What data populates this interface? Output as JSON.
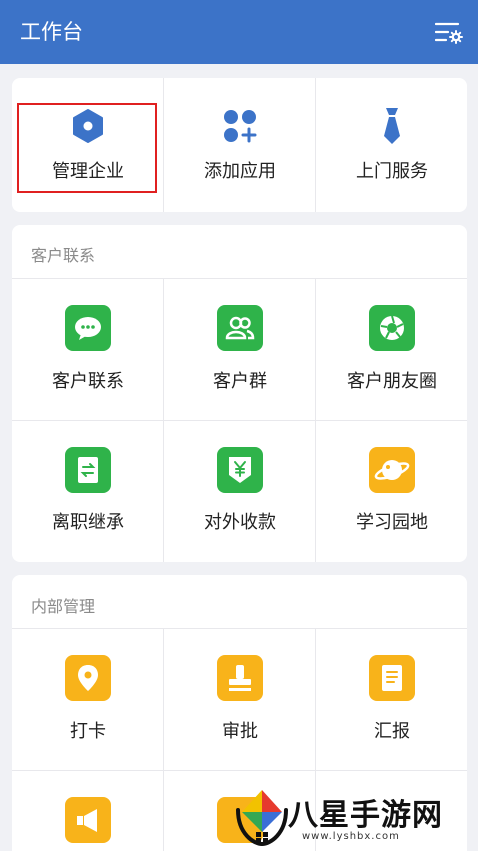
{
  "header": {
    "title": "工作台",
    "settings_icon": "settings-list-icon"
  },
  "top_actions": [
    {
      "label": "管理企业",
      "icon": "hexagon-icon",
      "color": "#3c73c8"
    },
    {
      "label": "添加应用",
      "icon": "apps-add-icon",
      "color": "#3c73c8"
    },
    {
      "label": "上门服务",
      "icon": "tie-icon",
      "color": "#3c73c8"
    }
  ],
  "customer_section": {
    "title": "客户联系",
    "items": [
      {
        "label": "客户联系",
        "icon": "chat-bubble-icon",
        "color": "#2fb34a"
      },
      {
        "label": "客户群",
        "icon": "group-icon",
        "color": "#2fb34a"
      },
      {
        "label": "客户朋友圈",
        "icon": "aperture-icon",
        "color": "#2fb34a"
      },
      {
        "label": "离职继承",
        "icon": "transfer-icon",
        "color": "#2fb34a"
      },
      {
        "label": "对外收款",
        "icon": "yuan-shield-icon",
        "color": "#2fb34a"
      },
      {
        "label": "学习园地",
        "icon": "planet-icon",
        "color": "#f8b31a"
      }
    ]
  },
  "internal_section": {
    "title": "内部管理",
    "items": [
      {
        "label": "打卡",
        "icon": "location-pin-icon",
        "color": "#f8b31a"
      },
      {
        "label": "审批",
        "icon": "stamp-icon",
        "color": "#f8b31a"
      },
      {
        "label": "汇报",
        "icon": "report-doc-icon",
        "color": "#f8b31a"
      },
      {
        "label": "",
        "icon": "megaphone-icon",
        "color": "#f8b31a"
      },
      {
        "label": "",
        "icon": "app-icon",
        "color": "#f8b31a"
      }
    ]
  },
  "watermark": {
    "text": "八星手游网",
    "url": "www.lyshbx.com"
  }
}
